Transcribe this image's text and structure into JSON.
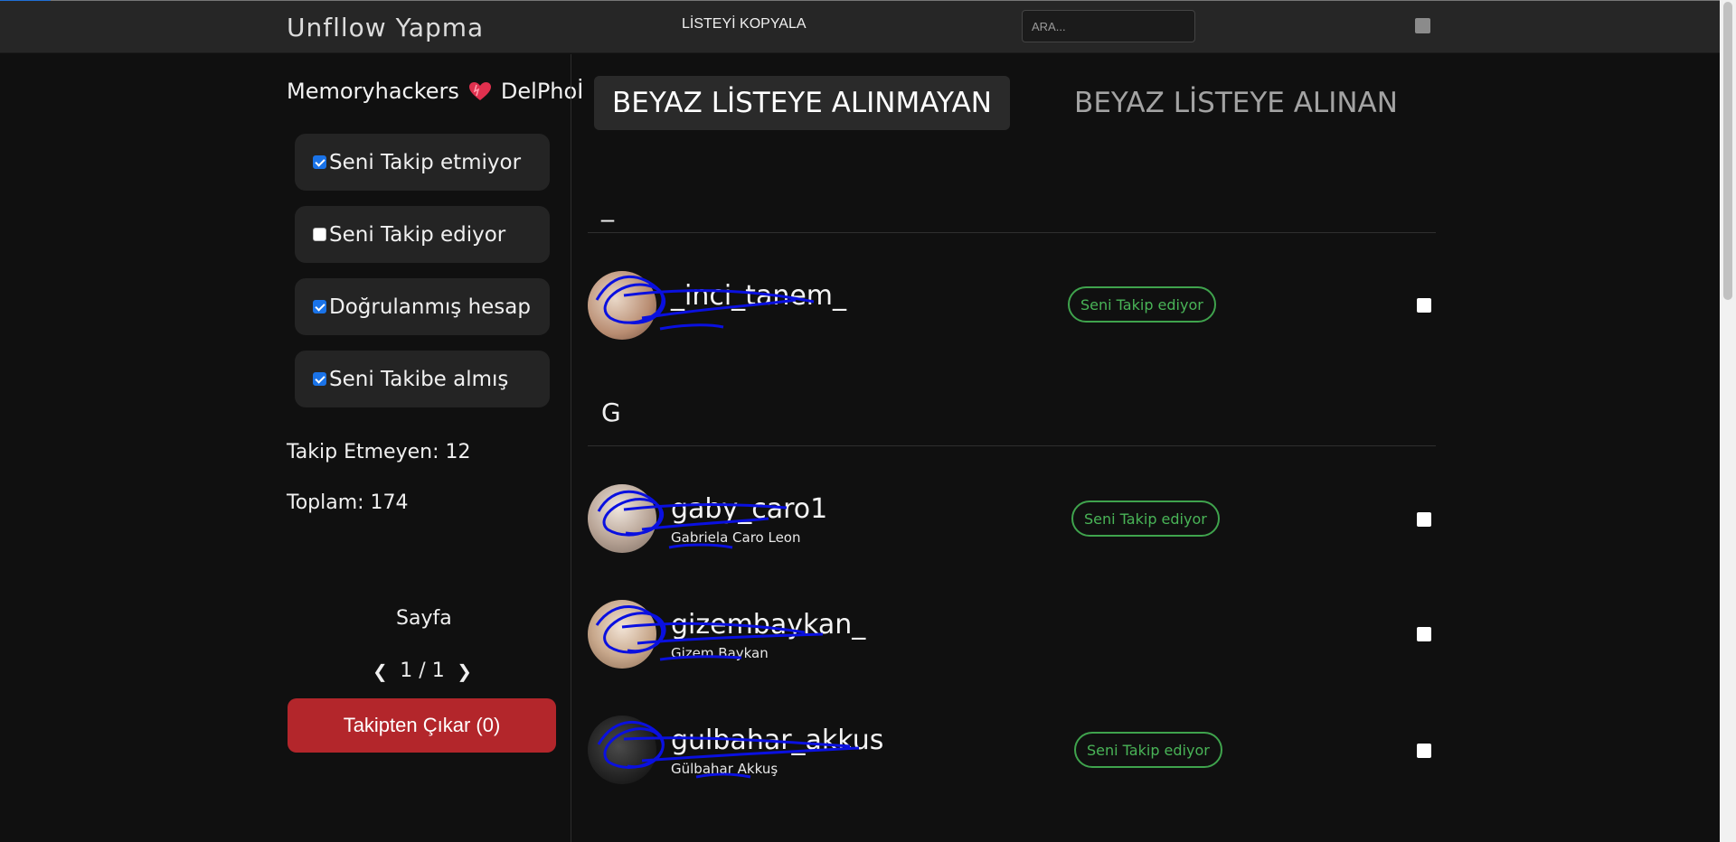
{
  "header": {
    "title": "Unfllow Yapma",
    "copy_list": "LİSTEYİ KOPYALA",
    "search_placeholder": "ARA..."
  },
  "sidebar": {
    "user_left": "Memoryhackers",
    "user_icon": "heart-icon",
    "user_right": "DelPhoİ",
    "filters": [
      {
        "label": "Seni Takip etmiyor",
        "checked": true
      },
      {
        "label": "Seni Takip ediyor",
        "checked": false
      },
      {
        "label": "Doğrulanmış hesap",
        "checked": true
      },
      {
        "label": "Seni Takibe almış",
        "checked": true
      }
    ],
    "stats": {
      "not_following": "Takip Etmeyen: 12",
      "total": "Toplam: 174"
    },
    "page_label": "Sayfa",
    "page_indicator": "1 / 1",
    "prev_icon": "chevron-left-icon",
    "next_icon": "chevron-right-icon",
    "unfollow_button": "Takipten Çıkar (0)"
  },
  "tabs": {
    "active": "BEYAZ LİSTEYE ALINMAYAN",
    "inactive": "BEYAZ LİSTEYE ALINAN"
  },
  "sections": [
    {
      "letter": "_",
      "users": [
        {
          "username": "_inci_tanem_",
          "fullname": "",
          "badge": "Seni Takip ediyor"
        }
      ]
    },
    {
      "letter": "G",
      "users": [
        {
          "username": "gaby_caro1",
          "fullname": "Gabriela Caro Leon",
          "badge": "Seni Takip ediyor"
        },
        {
          "username": "gizembaykan_",
          "fullname": "Gizem Baykan",
          "badge": ""
        },
        {
          "username": "gulbahar_akkus",
          "fullname": "Gülbahar Akkuş",
          "badge": "Seni Takip ediyor"
        }
      ]
    }
  ],
  "colors": {
    "background": "#101010",
    "header": "#262626",
    "accent_red": "#b3262b",
    "badge_green": "#49b457",
    "scribble_blue": "#0a10e0"
  }
}
